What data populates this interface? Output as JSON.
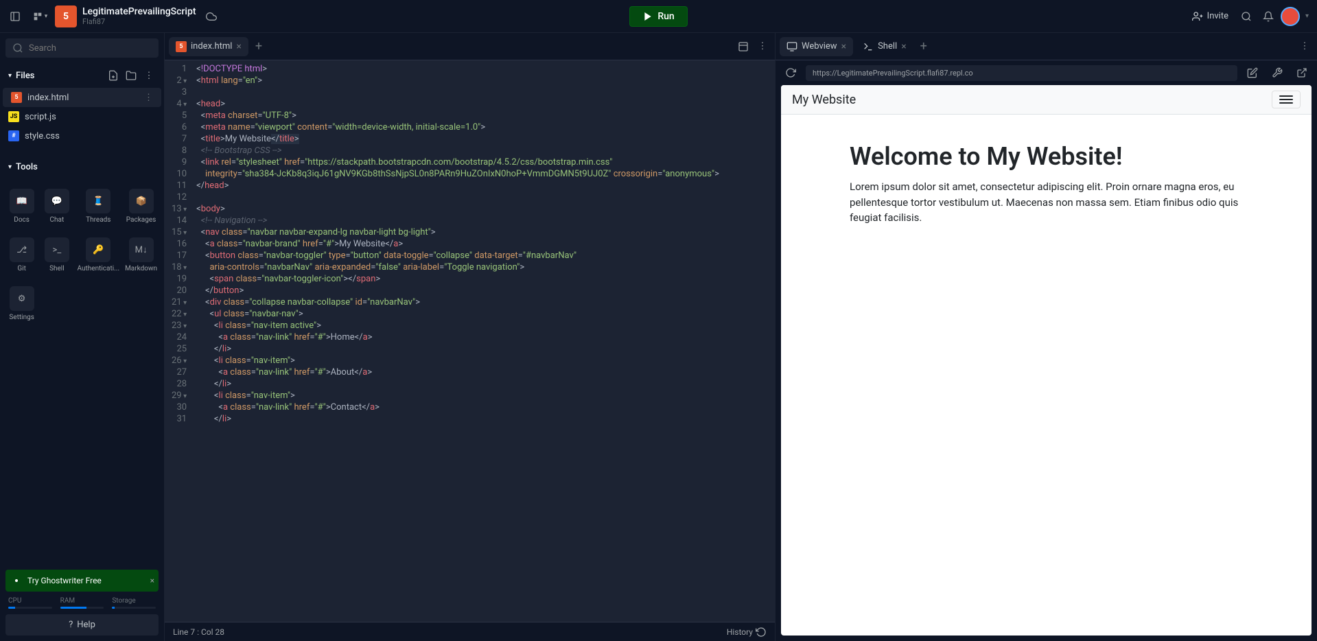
{
  "header": {
    "project_name": "LegitimatePrevailingScript",
    "owner": "Flafi87",
    "run_label": "Run",
    "invite_label": "Invite"
  },
  "sidebar": {
    "search_placeholder": "Search",
    "files_label": "Files",
    "files": [
      {
        "name": "index.html",
        "type": "html"
      },
      {
        "name": "script.js",
        "type": "js"
      },
      {
        "name": "style.css",
        "type": "css"
      }
    ],
    "tools_label": "Tools",
    "tools": [
      {
        "name": "Docs"
      },
      {
        "name": "Chat"
      },
      {
        "name": "Threads"
      },
      {
        "name": "Packages"
      },
      {
        "name": "Git"
      },
      {
        "name": "Shell"
      },
      {
        "name": "Authenticati..."
      },
      {
        "name": "Markdown"
      },
      {
        "name": "Settings"
      }
    ],
    "ghostwriter": "Try Ghostwriter Free",
    "stats": {
      "cpu": "CPU",
      "ram": "RAM",
      "storage": "Storage"
    },
    "help": "Help"
  },
  "editor": {
    "tab_name": "index.html",
    "status": "Line 7 : Col 28",
    "history": "History",
    "lines": [
      {
        "n": "1",
        "html": "<span class='pn'>&lt;</span><span class='doctype'>!DOCTYPE html</span><span class='pn'>&gt;</span>"
      },
      {
        "n": "2",
        "fold": true,
        "html": "<span class='pn'>&lt;</span><span class='tg'>html</span> <span class='at'>lang</span><span class='pn'>=</span><span class='st'>\"en\"</span><span class='pn'>&gt;</span>"
      },
      {
        "n": "3",
        "html": ""
      },
      {
        "n": "4",
        "fold": true,
        "html": "<span class='pn'>&lt;</span><span class='tg'>head</span><span class='pn'>&gt;</span>"
      },
      {
        "n": "5",
        "html": "  <span class='pn'>&lt;</span><span class='tg'>meta</span> <span class='at'>charset</span><span class='pn'>=</span><span class='st'>\"UTF-8\"</span><span class='pn'>&gt;</span>"
      },
      {
        "n": "6",
        "html": "  <span class='pn'>&lt;</span><span class='tg'>meta</span> <span class='at'>name</span><span class='pn'>=</span><span class='st'>\"viewport\"</span> <span class='at'>content</span><span class='pn'>=</span><span class='st'>\"width=device-width, initial-scale=1.0\"</span><span class='pn'>&gt;</span>"
      },
      {
        "n": "7",
        "html": "  <span class='pn'>&lt;</span><span class='tg'>title</span><span class='pn'>&gt;</span><span class='tx'>My Website</span><span class='hl'><span class='pn'>&lt;/</span><span class='tg'>title</span><span class='pn'>&gt;</span></span>"
      },
      {
        "n": "8",
        "html": "  <span class='cm'>&lt;!-- Bootstrap CSS --&gt;</span>"
      },
      {
        "n": "9",
        "html": "  <span class='pn'>&lt;</span><span class='tg'>link</span> <span class='at'>rel</span><span class='pn'>=</span><span class='st'>\"stylesheet\"</span> <span class='at'>href</span><span class='pn'>=</span><span class='st'>\"https://stackpath.bootstrapcdn.com/bootstrap/4.5.2/css/bootstrap.min.css\"</span>"
      },
      {
        "n": "10",
        "html": "    <span class='at'>integrity</span><span class='pn'>=</span><span class='st'>\"sha384-JcKb8q3iqJ61gNV9KGb8thSsNjpSL0n8PARn9HuZOnIxN0hoP+VmmDGMN5t9UJ0Z\"</span> <span class='at'>crossorigin</span><span class='pn'>=</span><span class='st'>\"anonymous\"</span><span class='pn'>&gt;</span>"
      },
      {
        "n": "11",
        "html": "<span class='pn'>&lt;/</span><span class='tg'>head</span><span class='pn'>&gt;</span>"
      },
      {
        "n": "12",
        "html": ""
      },
      {
        "n": "13",
        "fold": true,
        "html": "<span class='pn'>&lt;</span><span class='tg'>body</span><span class='pn'>&gt;</span>"
      },
      {
        "n": "14",
        "html": "  <span class='cm'>&lt;!-- Navigation --&gt;</span>"
      },
      {
        "n": "15",
        "fold": true,
        "html": "  <span class='pn'>&lt;</span><span class='tg'>nav</span> <span class='at'>class</span><span class='pn'>=</span><span class='st'>\"navbar navbar-expand-lg navbar-light bg-light\"</span><span class='pn'>&gt;</span>"
      },
      {
        "n": "16",
        "html": "    <span class='pn'>&lt;</span><span class='tg'>a</span> <span class='at'>class</span><span class='pn'>=</span><span class='st'>\"navbar-brand\"</span> <span class='at'>href</span><span class='pn'>=</span><span class='st'>\"#\"</span><span class='pn'>&gt;</span><span class='tx'>My Website</span><span class='pn'>&lt;/</span><span class='tg'>a</span><span class='pn'>&gt;</span>"
      },
      {
        "n": "17",
        "html": "    <span class='pn'>&lt;</span><span class='tg'>button</span> <span class='at'>class</span><span class='pn'>=</span><span class='st'>\"navbar-toggler\"</span> <span class='at'>type</span><span class='pn'>=</span><span class='st'>\"button\"</span> <span class='at'>data-toggle</span><span class='pn'>=</span><span class='st'>\"collapse\"</span> <span class='at'>data-target</span><span class='pn'>=</span><span class='st'>\"#navbarNav\"</span>"
      },
      {
        "n": "18",
        "fold": true,
        "html": "      <span class='at'>aria-controls</span><span class='pn'>=</span><span class='st'>\"navbarNav\"</span> <span class='at'>aria-expanded</span><span class='pn'>=</span><span class='st'>\"false\"</span> <span class='at'>aria-label</span><span class='pn'>=</span><span class='st'>\"Toggle navigation\"</span><span class='pn'>&gt;</span>"
      },
      {
        "n": "19",
        "html": "      <span class='pn'>&lt;</span><span class='tg'>span</span> <span class='at'>class</span><span class='pn'>=</span><span class='st'>\"navbar-toggler-icon\"</span><span class='pn'>&gt;&lt;/</span><span class='tg'>span</span><span class='pn'>&gt;</span>"
      },
      {
        "n": "20",
        "html": "    <span class='pn'>&lt;/</span><span class='tg'>button</span><span class='pn'>&gt;</span>"
      },
      {
        "n": "21",
        "fold": true,
        "html": "    <span class='pn'>&lt;</span><span class='tg'>div</span> <span class='at'>class</span><span class='pn'>=</span><span class='st'>\"collapse navbar-collapse\"</span> <span class='at'>id</span><span class='pn'>=</span><span class='st'>\"navbarNav\"</span><span class='pn'>&gt;</span>"
      },
      {
        "n": "22",
        "fold": true,
        "html": "      <span class='pn'>&lt;</span><span class='tg'>ul</span> <span class='at'>class</span><span class='pn'>=</span><span class='st'>\"navbar-nav\"</span><span class='pn'>&gt;</span>"
      },
      {
        "n": "23",
        "fold": true,
        "html": "        <span class='pn'>&lt;</span><span class='tg'>li</span> <span class='at'>class</span><span class='pn'>=</span><span class='st'>\"nav-item active\"</span><span class='pn'>&gt;</span>"
      },
      {
        "n": "24",
        "html": "          <span class='pn'>&lt;</span><span class='tg'>a</span> <span class='at'>class</span><span class='pn'>=</span><span class='st'>\"nav-link\"</span> <span class='at'>href</span><span class='pn'>=</span><span class='st'>\"#\"</span><span class='pn'>&gt;</span><span class='tx'>Home</span><span class='pn'>&lt;/</span><span class='tg'>a</span><span class='pn'>&gt;</span>"
      },
      {
        "n": "25",
        "html": "        <span class='pn'>&lt;/</span><span class='tg'>li</span><span class='pn'>&gt;</span>"
      },
      {
        "n": "26",
        "fold": true,
        "html": "        <span class='pn'>&lt;</span><span class='tg'>li</span> <span class='at'>class</span><span class='pn'>=</span><span class='st'>\"nav-item\"</span><span class='pn'>&gt;</span>"
      },
      {
        "n": "27",
        "html": "          <span class='pn'>&lt;</span><span class='tg'>a</span> <span class='at'>class</span><span class='pn'>=</span><span class='st'>\"nav-link\"</span> <span class='at'>href</span><span class='pn'>=</span><span class='st'>\"#\"</span><span class='pn'>&gt;</span><span class='tx'>About</span><span class='pn'>&lt;/</span><span class='tg'>a</span><span class='pn'>&gt;</span>"
      },
      {
        "n": "28",
        "html": "        <span class='pn'>&lt;/</span><span class='tg'>li</span><span class='pn'>&gt;</span>"
      },
      {
        "n": "29",
        "fold": true,
        "html": "        <span class='pn'>&lt;</span><span class='tg'>li</span> <span class='at'>class</span><span class='pn'>=</span><span class='st'>\"nav-item\"</span><span class='pn'>&gt;</span>"
      },
      {
        "n": "30",
        "html": "          <span class='pn'>&lt;</span><span class='tg'>a</span> <span class='at'>class</span><span class='pn'>=</span><span class='st'>\"nav-link\"</span> <span class='at'>href</span><span class='pn'>=</span><span class='st'>\"#\"</span><span class='pn'>&gt;</span><span class='tx'>Contact</span><span class='pn'>&lt;/</span><span class='tg'>a</span><span class='pn'>&gt;</span>"
      },
      {
        "n": "31",
        "html": "        <span class='pn'>&lt;/</span><span class='tg'>li</span><span class='pn'>&gt;</span>"
      }
    ]
  },
  "preview": {
    "webview_tab": "Webview",
    "shell_tab": "Shell",
    "url": "https://LegitimatePrevailingScript.flafi87.repl.co",
    "brand": "My Website",
    "heading": "Welcome to My Website!",
    "paragraph": "Lorem ipsum dolor sit amet, consectetur adipiscing elit. Proin ornare magna eros, eu pellentesque tortor vestibulum ut. Maecenas non massa sem. Etiam finibus odio quis feugiat facilisis."
  }
}
